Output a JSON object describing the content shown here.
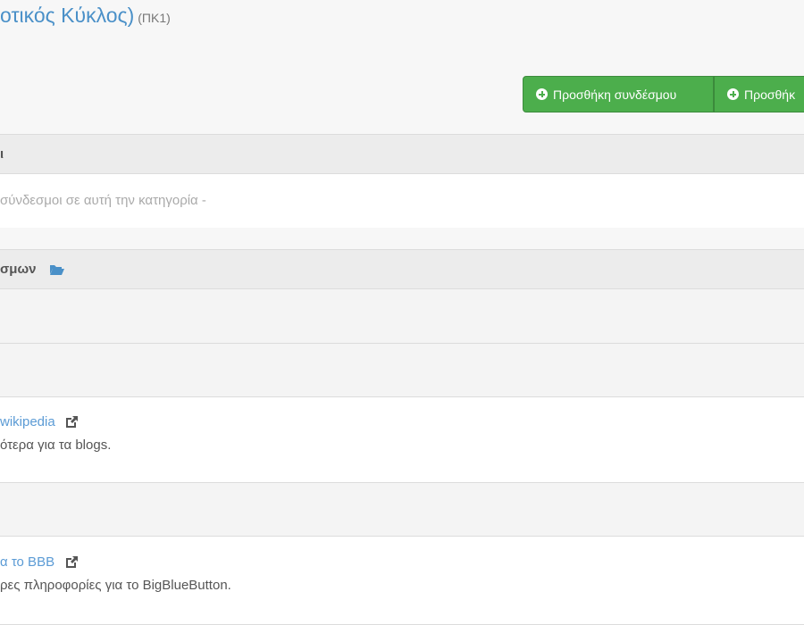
{
  "page": {
    "title": "οτικός Κύκλος)",
    "code": "(ΠΚ1)"
  },
  "toolbar": {
    "add_link_label": "Προσθήκη συνδέσμου",
    "add_category_label": "Προσθήκ"
  },
  "uncategorized": {
    "header": "ι",
    "empty_message": "σύνδεσμοι σε αυτή την κατηγορία -"
  },
  "categories": {
    "header": "σμων",
    "folder_icon": "folder-open-icon"
  },
  "links": [
    {
      "title": "wikipedia",
      "description": "ότερα για τα blogs.",
      "icon": "external-link-icon"
    },
    {
      "title": "α το BBB",
      "description": "ρες πληροφορίες για το BigBlueButton.",
      "icon": "external-link-icon"
    }
  ],
  "colors": {
    "accent": "#4a90c8",
    "button_green": "#4cae4c"
  }
}
